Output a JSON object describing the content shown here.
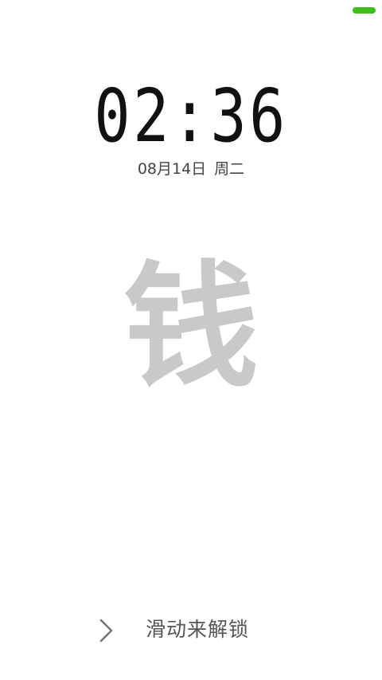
{
  "status_bar": {
    "battery_color": "#3cbf1c"
  },
  "lock_screen": {
    "time": "02:36",
    "date": "08月14日",
    "weekday": "周二",
    "wallpaper_text": "钱",
    "unlock_hint": "滑动来解锁",
    "unlock_icon": "chevron-right-icon"
  }
}
